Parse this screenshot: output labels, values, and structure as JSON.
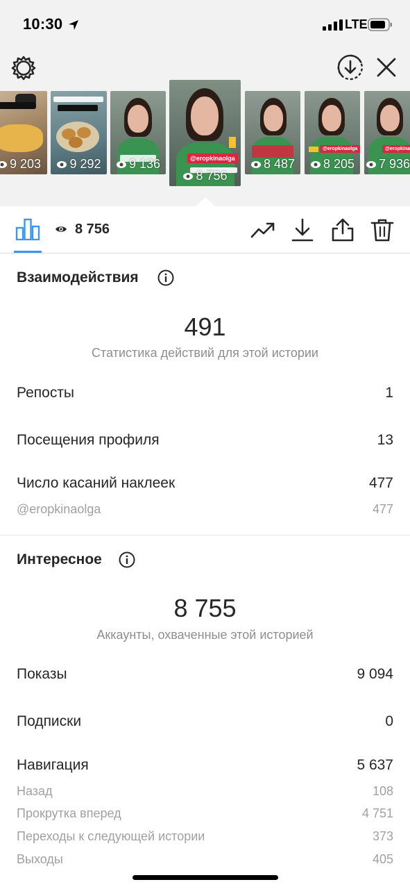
{
  "status_bar": {
    "time": "10:30",
    "network": "LTE"
  },
  "header": {
    "settings_icon": "gear-icon",
    "save_icon": "download-circle-icon",
    "close_icon": "close-icon"
  },
  "stories": [
    {
      "views": "9 203",
      "kind": "food"
    },
    {
      "views": "9 292",
      "kind": "food"
    },
    {
      "views": "9 136",
      "kind": "selfie"
    },
    {
      "views": "8 756",
      "kind": "selfie",
      "selected": true,
      "tag": "@eropkinaolga"
    },
    {
      "views": "8 487",
      "kind": "selfie"
    },
    {
      "views": "8 205",
      "kind": "selfie",
      "tag": "@eropkinaolga"
    },
    {
      "views": "7 936",
      "kind": "selfie",
      "tag": "@eropkinaolga"
    }
  ],
  "toolbar": {
    "views": "8 756",
    "icons": [
      "bar-chart-icon",
      "eye-icon",
      "trending-icon",
      "download-icon",
      "share-icon",
      "trash-icon"
    ]
  },
  "interactions": {
    "title": "Взаимодействия",
    "total": "491",
    "subtitle": "Статистика действий для этой истории",
    "rows": [
      {
        "label": "Репосты",
        "value": "1"
      },
      {
        "label": "Посещения профиля",
        "value": "13"
      },
      {
        "label": "Число касаний наклеек",
        "value": "477"
      },
      {
        "label": "@eropkinaolga",
        "value": "477"
      }
    ]
  },
  "discovery": {
    "title": "Интересное",
    "total": "8 755",
    "subtitle": "Аккаунты, охваченные этой историей",
    "rows": [
      {
        "label": "Показы",
        "value": "9 094"
      },
      {
        "label": "Подписки",
        "value": "0"
      },
      {
        "label": "Навигация",
        "value": "5 637"
      },
      {
        "label": "Назад",
        "value": "108"
      },
      {
        "label": "Прокрутка вперед",
        "value": "4 751"
      },
      {
        "label": "Переходы к следующей истории",
        "value": "373"
      },
      {
        "label": "Выходы",
        "value": "405"
      }
    ]
  },
  "colors": {
    "accent": "#3897f0",
    "top_background": "#f2f2f3",
    "sticker_tag": "#d8273e"
  }
}
